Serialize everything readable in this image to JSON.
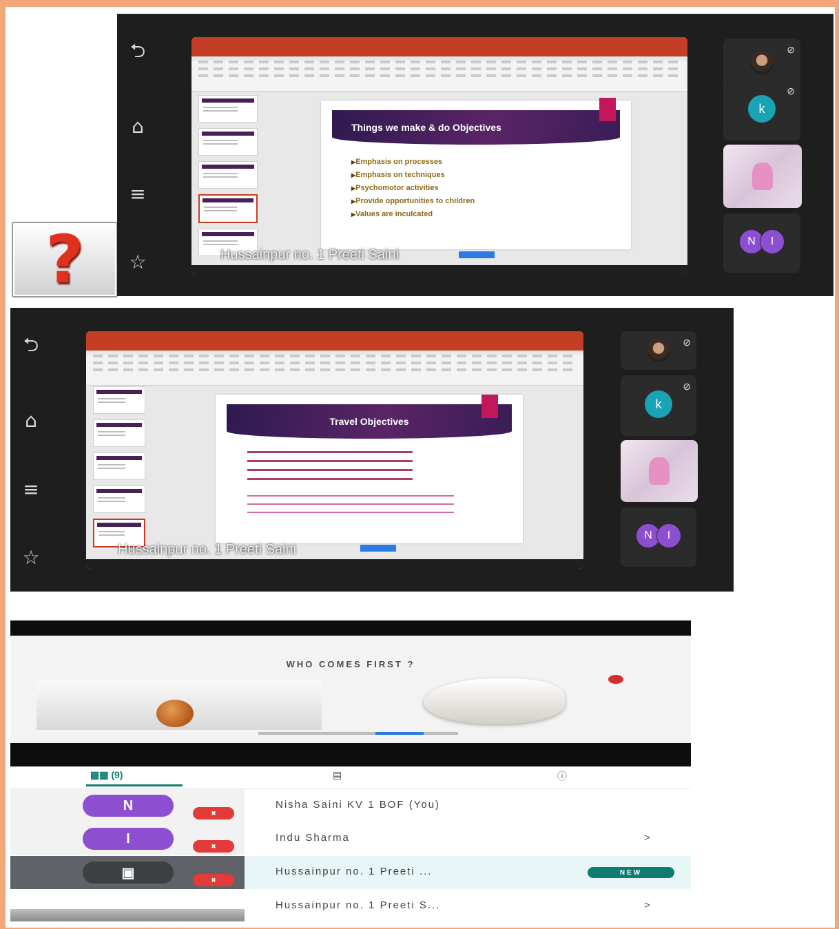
{
  "panel1": {
    "nav": [
      "⮌",
      "⌂",
      "≡",
      "☆"
    ],
    "slide_title": "Things we make & do Objectives",
    "bullets": [
      "Emphasis on processes",
      "Emphasis on techniques",
      "Psychomotor activities",
      "Provide opportunities to children",
      "Values are inculcated"
    ],
    "presenter": "Hussainpur no. 1 Preeti Saini"
  },
  "panel2": {
    "slide_title": "Travel Objectives",
    "presenter": "Hussainpur no. 1 Preeti Saini"
  },
  "tiles": {
    "k_letter": "k",
    "pair": [
      "N",
      "I"
    ]
  },
  "phone": {
    "video_title": "WHO COMES FIRST ?",
    "people_tab": "(9)",
    "participants": [
      {
        "initial": "N",
        "name": "Nisha Saini KV 1 BOF (You)",
        "chev": ""
      },
      {
        "initial": "I",
        "name": "Indu Sharma",
        "chev": ">"
      },
      {
        "initial": "",
        "name": "Hussainpur no. 1 Preeti ...",
        "chev": "",
        "badge": "NEW"
      },
      {
        "initial": "",
        "name": "Hussainpur no. 1 Preeti S...",
        "chev": ">"
      }
    ]
  },
  "colors": {
    "accent_teal": "#0f7c71",
    "avatar_purple": "#8d4fd1",
    "ppt_red": "#c33e24"
  }
}
